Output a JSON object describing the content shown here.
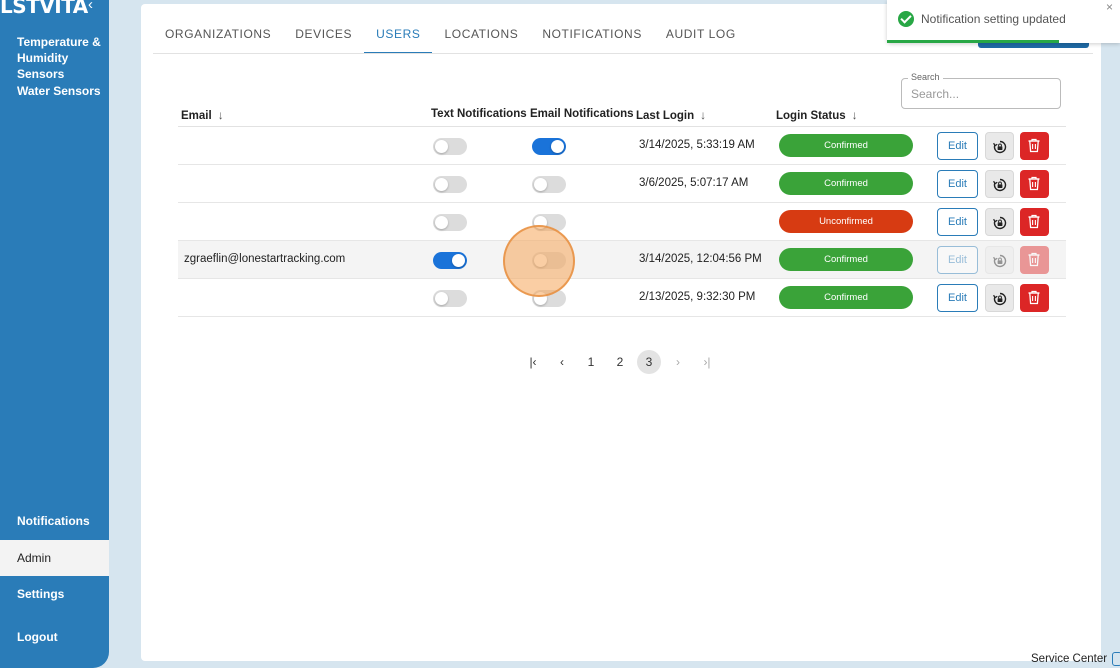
{
  "sidebar": {
    "logo": "LSTVITA",
    "collapse_icon": "chevron-left-icon",
    "items": [
      {
        "label": "Temperature & Humidity Sensors"
      },
      {
        "label": "Water Sensors"
      },
      {
        "label": "Notifications"
      },
      {
        "label": "Admin",
        "active": true
      },
      {
        "label": "Settings"
      },
      {
        "label": "Logout"
      }
    ]
  },
  "tabs": [
    {
      "label": "ORGANIZATIONS"
    },
    {
      "label": "DEVICES"
    },
    {
      "label": "USERS",
      "active": true
    },
    {
      "label": "LOCATIONS"
    },
    {
      "label": "NOTIFICATIONS"
    },
    {
      "label": "AUDIT LOG"
    }
  ],
  "search": {
    "legend": "Search",
    "placeholder": "Search..."
  },
  "table": {
    "headers": {
      "email": "Email",
      "text_notifications": "Text Notifications",
      "email_notifications": "Email Notifications",
      "last_login": "Last Login",
      "login_status": "Login Status"
    },
    "rows": [
      {
        "email": "",
        "text_on": false,
        "email_on": true,
        "last_login": "3/14/2025, 5:33:19 AM",
        "status": "Confirmed",
        "status_type": "ok"
      },
      {
        "email": "",
        "text_on": false,
        "email_on": false,
        "last_login": "3/6/2025, 5:07:17 AM",
        "status": "Confirmed",
        "status_type": "ok"
      },
      {
        "email": "",
        "text_on": false,
        "email_on": false,
        "last_login": "",
        "status": "Unconfirmed",
        "status_type": "bad"
      },
      {
        "email": "zgraeflin@lonestartracking.com",
        "text_on": true,
        "email_on": false,
        "last_login": "3/14/2025, 12:04:56 PM",
        "status": "Confirmed",
        "status_type": "ok",
        "highlight": true
      },
      {
        "email": "",
        "text_on": false,
        "email_on": false,
        "last_login": "2/13/2025, 9:32:30 PM",
        "status": "Confirmed",
        "status_type": "ok"
      }
    ],
    "edit_label": "Edit"
  },
  "pagination": {
    "pages": [
      "1",
      "2",
      "3"
    ],
    "current": "3"
  },
  "toast": {
    "message": "Notification setting updated",
    "close": "×"
  },
  "footer": {
    "service_center": "Service Center"
  },
  "colors": {
    "primary": "#2a7cb8",
    "confirmed": "#3aa339",
    "unconfirmed": "#d73b12",
    "danger": "#dc2626",
    "toggle_on": "#1a73d9"
  }
}
